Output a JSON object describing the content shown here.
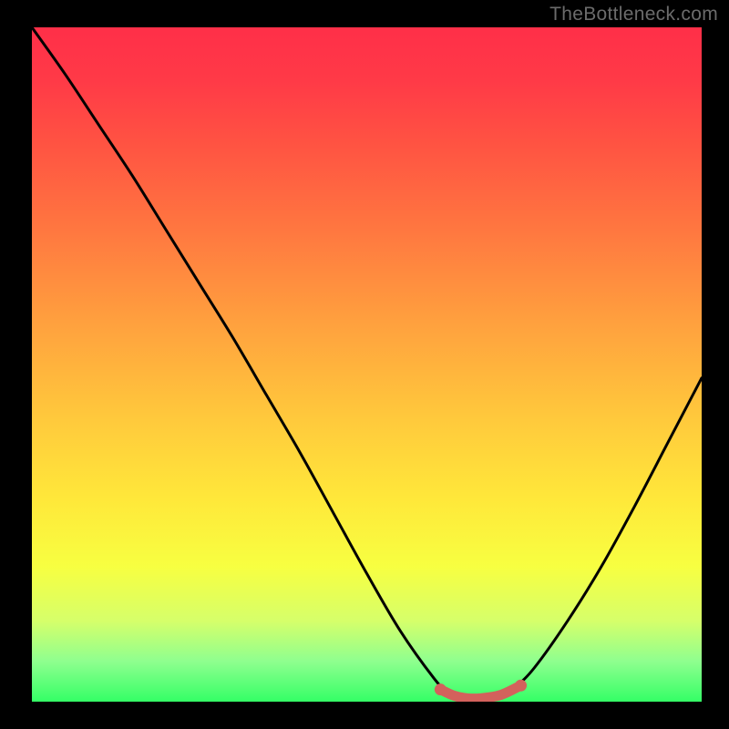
{
  "watermark": "TheBottleneck.com",
  "chart_data": {
    "type": "line",
    "title": "",
    "xlabel": "",
    "ylabel": "",
    "xlim": [
      0,
      100
    ],
    "ylim": [
      0,
      100
    ],
    "x": [
      0,
      5,
      10,
      15,
      20,
      25,
      30,
      35,
      40,
      45,
      50,
      55,
      60,
      62,
      64,
      66,
      68,
      70,
      72,
      75,
      80,
      85,
      90,
      95,
      100
    ],
    "values": [
      100,
      93,
      85.5,
      78,
      70,
      62,
      54,
      45.5,
      37,
      28,
      19,
      10.5,
      3.5,
      1.5,
      0.6,
      0.3,
      0.4,
      0.7,
      2,
      5,
      12,
      20,
      29,
      38.5,
      48
    ],
    "marker_points": {
      "x": [
        61,
        63,
        65,
        67,
        70,
        73
      ],
      "y": [
        1.8,
        0.9,
        0.5,
        0.5,
        1.0,
        2.4
      ]
    },
    "colors": {
      "line": "#000000",
      "markers": "#d3615c",
      "gradient_top": "#ff2f48",
      "gradient_bottom": "#34ff66"
    }
  }
}
